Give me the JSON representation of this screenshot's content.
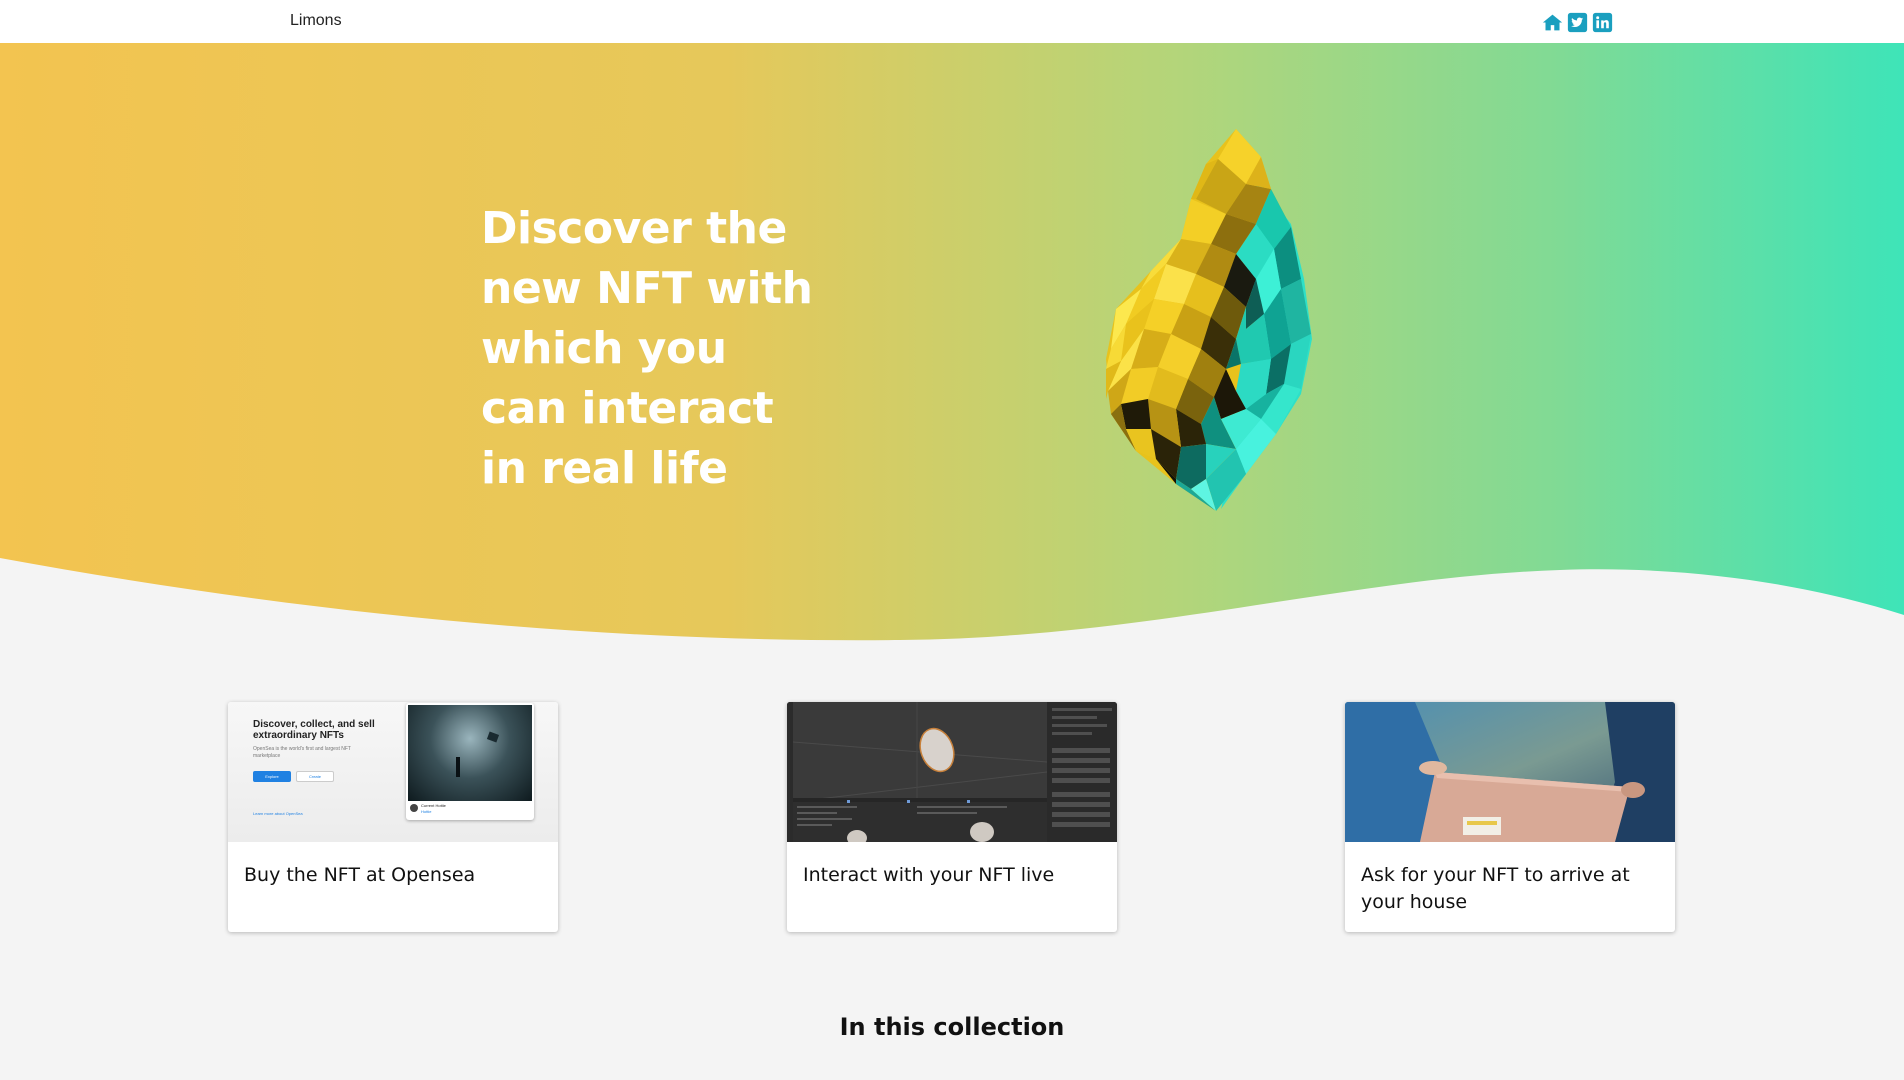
{
  "nav": {
    "brand": "Limons",
    "icons": [
      "home-icon",
      "twitter-icon",
      "linkedin-icon"
    ],
    "icon_color": "#1a9fbf"
  },
  "hero": {
    "title": "Discover the new NFT with which you can interact in real life",
    "gradient": [
      "#f3c450",
      "#c8cf6a",
      "#8bd98c",
      "#3ee4b8"
    ]
  },
  "cards": [
    {
      "caption": "Buy the NFT at Opensea",
      "thumb_heading": "Discover, collect, and sell extraordinary NFTs",
      "thumb_text": "OpenSea is the world's first and largest NFT marketplace",
      "thumb_btn_primary": "Explore",
      "thumb_btn_secondary": "Create",
      "thumb_link": "Learn more about OpenSea",
      "thumb_creator": "Current Hottie",
      "thumb_creator_sub": "Hottie"
    },
    {
      "caption": "Interact with your NFT live"
    },
    {
      "caption": "Ask for your NFT to arrive at your house"
    }
  ],
  "collection": {
    "title": "In this collection"
  }
}
